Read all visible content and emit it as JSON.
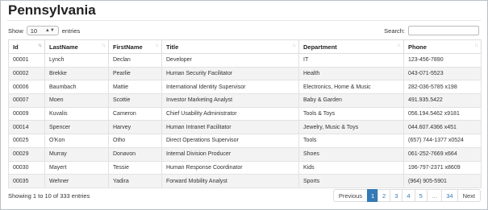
{
  "page": {
    "title": "Pennsylvania"
  },
  "length": {
    "show_label": "Show",
    "value": "10",
    "entries_label": "entries"
  },
  "search": {
    "label": "Search:",
    "value": ""
  },
  "table": {
    "columns": [
      "Id",
      "LastName",
      "FirstName",
      "Title",
      "Department",
      "Phone"
    ],
    "sorted_column": "Id",
    "rows": [
      [
        "00001",
        "Lynch",
        "Declan",
        "Developer",
        "IT",
        "123-456-7890"
      ],
      [
        "00002",
        "Brekke",
        "Pearlie",
        "Human Security Facilitator",
        "Health",
        "043-071-5523"
      ],
      [
        "00006",
        "Baumbach",
        "Mattie",
        "International Identity Supervisor",
        "Electronics, Home & Music",
        "282-036-5785 x198"
      ],
      [
        "00007",
        "Moen",
        "Scottie",
        "Investor Marketing Analyst",
        "Baby & Garden",
        "491.935.5422"
      ],
      [
        "00009",
        "Kuvalis",
        "Cameron",
        "Chief Usability Administrator",
        "Tools & Toys",
        "056.194.5462 x9181"
      ],
      [
        "00014",
        "Spencer",
        "Harvey",
        "Human Intranet Facilitator",
        "Jewelry, Music & Toys",
        "044.607.4366 x451"
      ],
      [
        "00025",
        "O'Kon",
        "Otho",
        "Direct Operations Supervisor",
        "Tools",
        "(657) 744-1377 x0524"
      ],
      [
        "00029",
        "Murray",
        "Donavon",
        "Internal Division Producer",
        "Shoes",
        "061-252-7669 x664"
      ],
      [
        "00030",
        "Mayert",
        "Tessie",
        "Human Response Coordinator",
        "Kids",
        "196-797-2371 x8609"
      ],
      [
        "00035",
        "Wehner",
        "Yadira",
        "Forward Mobility Analyst",
        "Sports",
        "(964) 905-5901"
      ]
    ]
  },
  "info": "Showing 1 to 10 of 333 entries",
  "pagination": {
    "previous": "Previous",
    "pages": [
      "1",
      "2",
      "3",
      "4",
      "5",
      "…",
      "34"
    ],
    "current": "1",
    "next": "Next"
  },
  "colors": {
    "accent": "#337ab7",
    "stripe": "#f3f3f3",
    "border": "#dddddd"
  },
  "icons": {
    "sort": "sort-arrows-icon",
    "select": "select-arrows-icon"
  }
}
